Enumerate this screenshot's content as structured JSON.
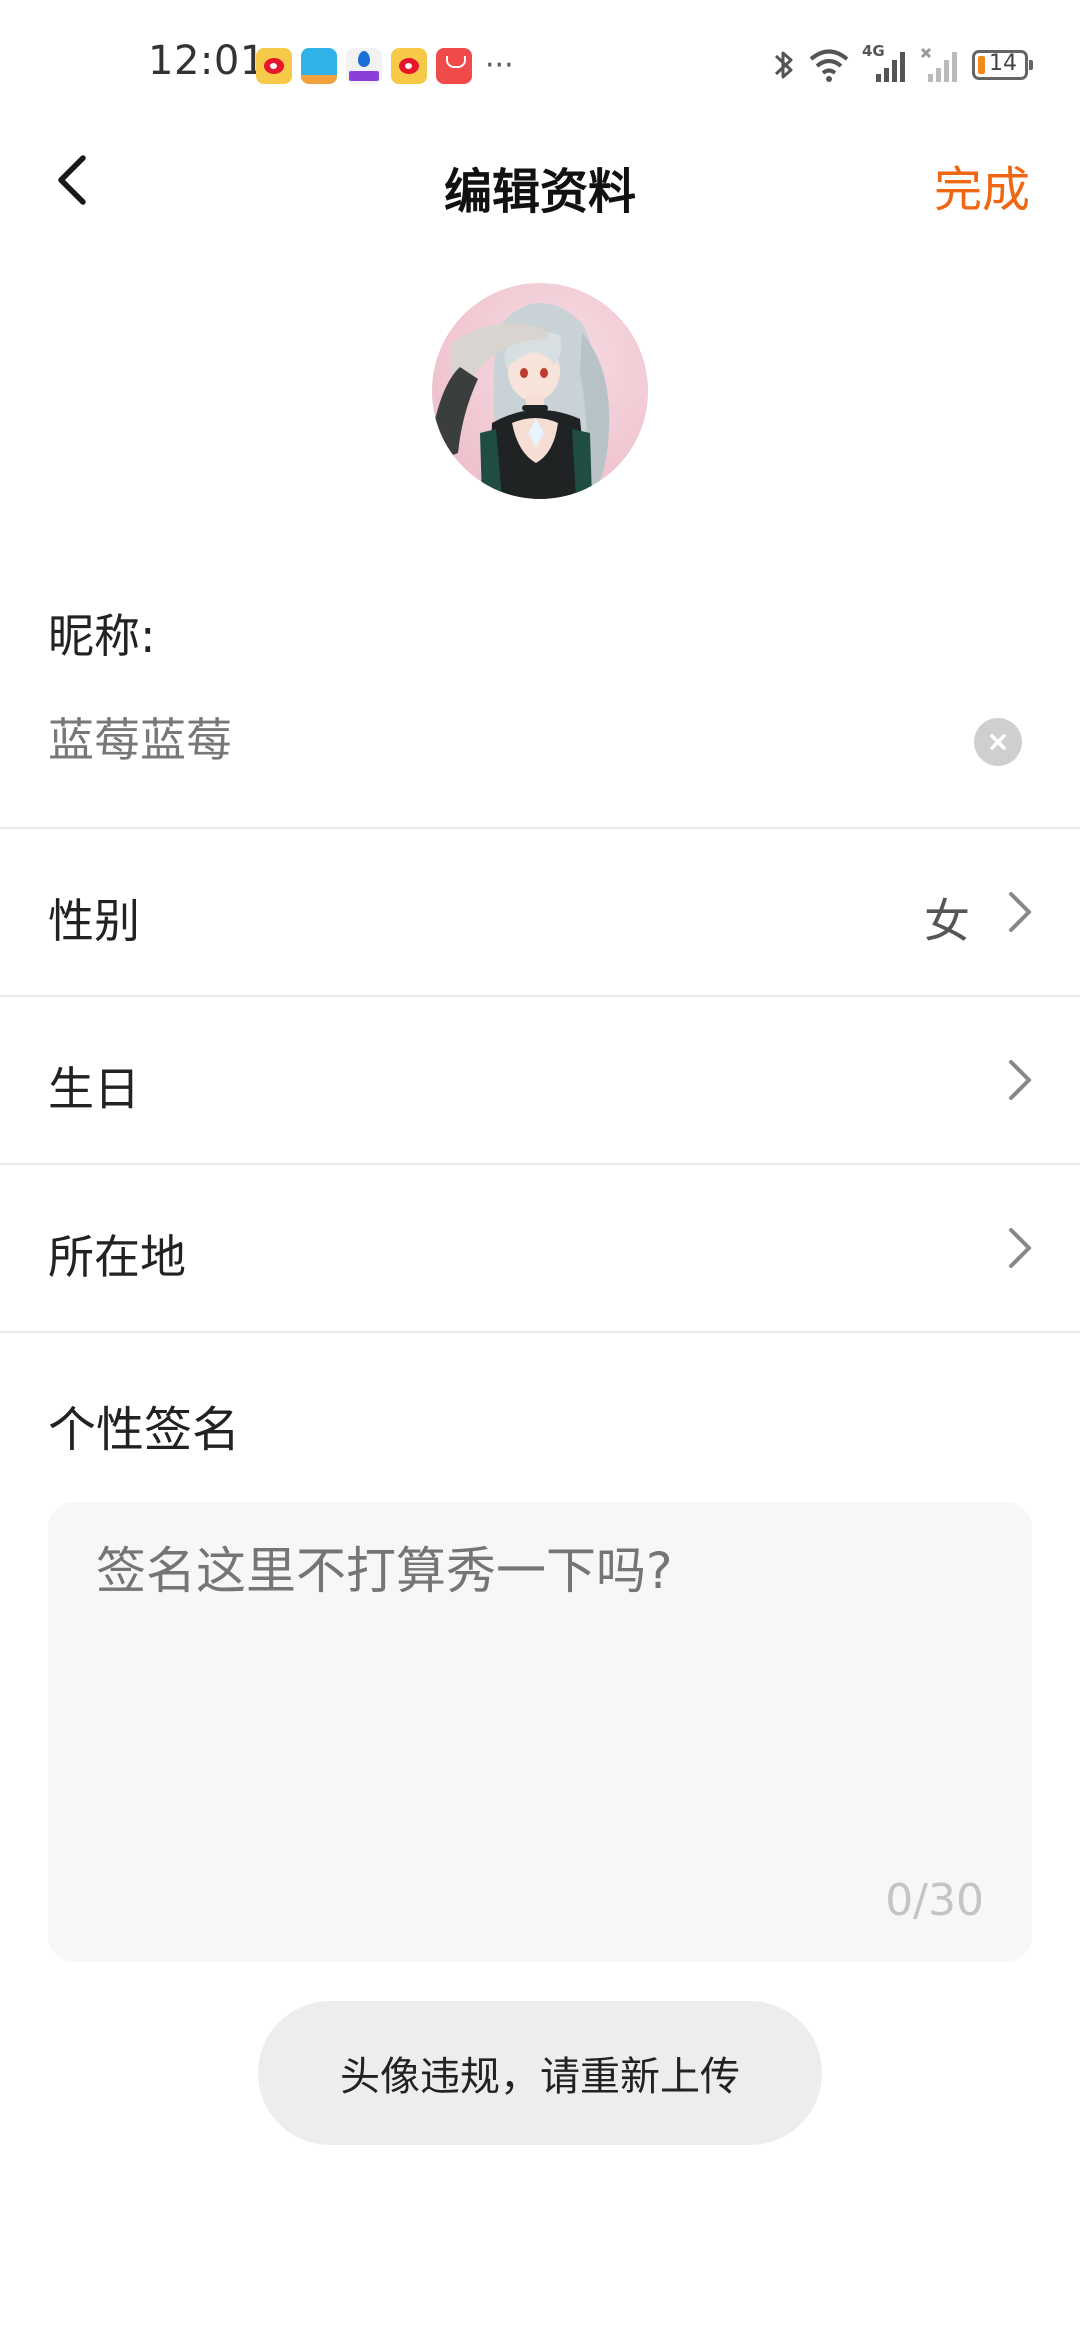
{
  "status_bar": {
    "time": "12:01",
    "app_icons": [
      "weibo-icon",
      "camel-app-icon",
      "drop-app-icon",
      "weibo-icon",
      "huawei-store-icon"
    ],
    "more": "···",
    "network": "4G",
    "battery": "14",
    "battery_level_percent": 14,
    "battery_color": "#f08a1c"
  },
  "header": {
    "title": "编辑资料",
    "done_label": "完成",
    "accent_color": "#f06611"
  },
  "profile": {
    "nickname_label": "昵称:",
    "nickname_value": "蓝莓蓝莓",
    "rows": [
      {
        "label": "性别",
        "value": "女"
      },
      {
        "label": "生日",
        "value": ""
      },
      {
        "label": "所在地",
        "value": ""
      }
    ],
    "signature_label": "个性签名",
    "signature_placeholder": "签名这里不打算秀一下吗?",
    "signature_counter": "0/30"
  },
  "toast": {
    "message": "头像违规，请重新上传"
  }
}
